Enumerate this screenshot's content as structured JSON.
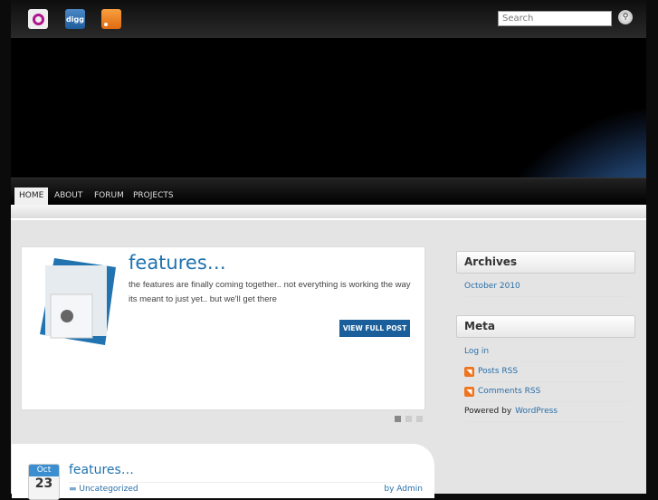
{
  "header": {
    "social": [
      {
        "name": "openid"
      },
      {
        "name": "digg",
        "label": "digg"
      },
      {
        "name": "rss"
      }
    ],
    "search_placeholder": "Search"
  },
  "nav": [
    "HOME",
    "ABOUT",
    "FORUM",
    "PROJECTS"
  ],
  "featured": {
    "title": "features…",
    "excerpt": "the features are finally coming together.. not everything is working the way its meant to just yet.. but we'll get there",
    "button": "VIEW FULL POST",
    "slides": 3,
    "active_slide": 1
  },
  "post": {
    "month": "Oct",
    "day": "23",
    "title": "features…",
    "category": "Uncategorized",
    "author": "by Admin"
  },
  "sidebar": {
    "archives_title": "Archives",
    "archives": [
      "October 2010"
    ],
    "meta_title": "Meta",
    "meta": {
      "login": "Log in",
      "posts_rss": "Posts RSS",
      "comments_rss": "Comments RSS",
      "powered": "Powered by",
      "wordpress": "WordPress"
    }
  },
  "colors": {
    "accent": "#1f73b0",
    "button": "#1a5f9c"
  }
}
